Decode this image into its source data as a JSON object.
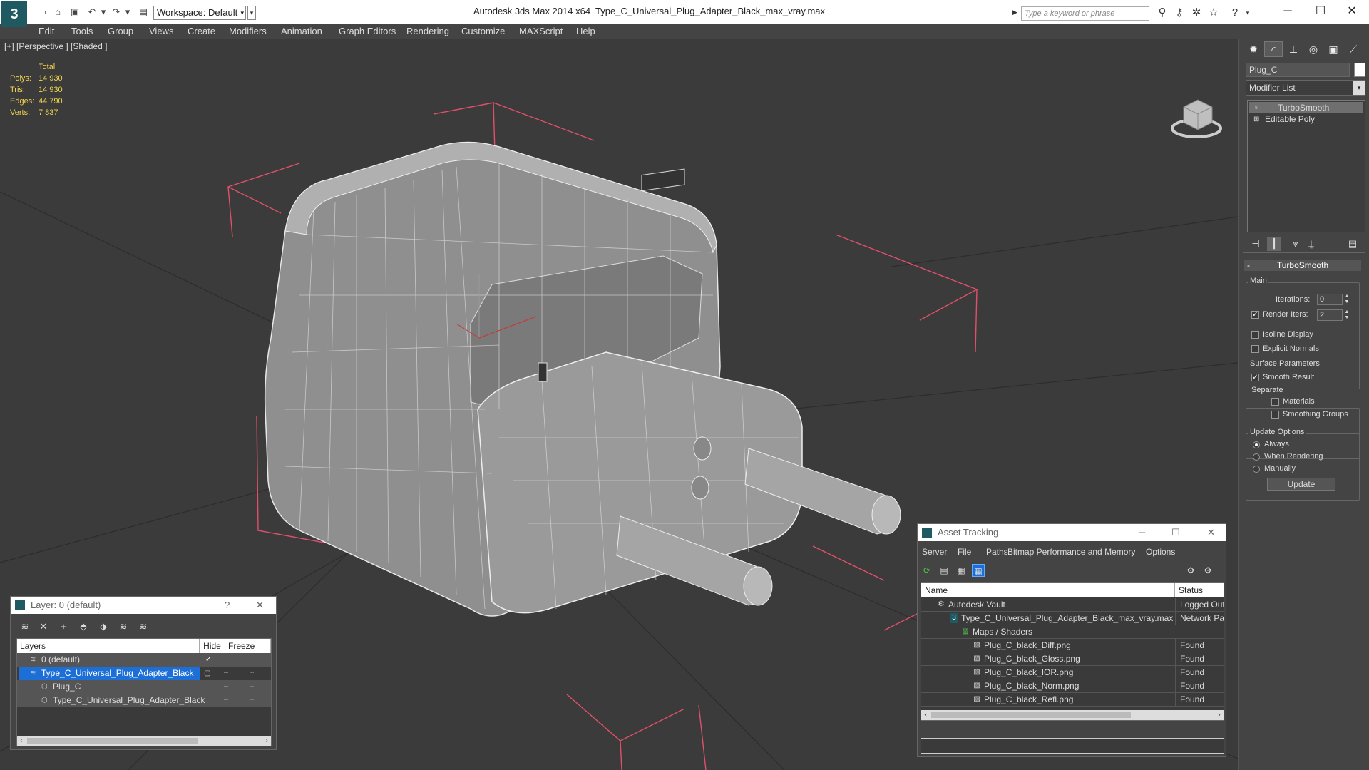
{
  "titlebar": {
    "app_title": "Autodesk 3ds Max  2014 x64",
    "file_title": "Type_C_Universal_Plug_Adapter_Black_max_vray.max",
    "workspace": "Workspace: Default",
    "search_placeholder": "Type a keyword or phrase",
    "quick_access_icons": [
      "new-file-icon",
      "open-file-icon",
      "save-icon",
      "undo-icon",
      "redo-icon",
      "project-folder-icon"
    ],
    "right_icons": [
      "binoculars-icon",
      "search-icon",
      "star-tools-icon",
      "favorites-icon",
      "help-icon"
    ]
  },
  "menu": [
    "Edit",
    "Tools",
    "Group",
    "Views",
    "Create",
    "Modifiers",
    "Animation",
    "Graph Editors",
    "Rendering",
    "Customize",
    "MAXScript",
    "Help"
  ],
  "viewport": {
    "label": "[+] [Perspective ] [Shaded ]",
    "stats": {
      "header": "Total",
      "rows": [
        {
          "k": "Polys:",
          "v": "14 930"
        },
        {
          "k": "Tris:",
          "v": "14 930"
        },
        {
          "k": "Edges:",
          "v": "44 790"
        },
        {
          "k": "Verts:",
          "v": "7 837"
        }
      ]
    }
  },
  "command_panel": {
    "tabs": [
      "create-tab-icon",
      "modify-tab-icon",
      "hierarchy-tab-icon",
      "motion-tab-icon",
      "display-tab-icon",
      "utilities-tab-icon"
    ],
    "object_name": "Plug_C",
    "modifier_list": "Modifier List",
    "stack": [
      "TurboSmooth",
      "Editable Poly"
    ],
    "rollout_title": "TurboSmooth",
    "main_group": "Main",
    "iterations_label": "Iterations:",
    "iterations_value": "0",
    "render_iters_label": "Render Iters:",
    "render_iters_value": "2",
    "render_iters_checked": true,
    "isoline_label": "Isoline Display",
    "explicit_normals_label": "Explicit Normals",
    "surface_group": "Surface Parameters",
    "smooth_result_label": "Smooth Result",
    "separate_label": "Separate",
    "materials_label": "Materials",
    "smoothing_groups_label": "Smoothing Groups",
    "update_group": "Update Options",
    "always_label": "Always",
    "when_rendering_label": "When Rendering",
    "manually_label": "Manually",
    "update_button": "Update"
  },
  "layer_dialog": {
    "title": "Layer: 0 (default)",
    "help": "?",
    "headers": {
      "layers": "Layers",
      "hide": "Hide",
      "freeze": "Freeze"
    },
    "rows": [
      {
        "name": "0 (default)"
      },
      {
        "name": "Type_C_Universal_Plug_Adapter_Black"
      },
      {
        "name": "Plug_C"
      },
      {
        "name": "Type_C_Universal_Plug_Adapter_Black"
      }
    ]
  },
  "asset_dialog": {
    "title": "Asset Tracking",
    "menu": [
      "Server",
      "File",
      "Paths",
      "Bitmap Performance and Memory",
      "Options"
    ],
    "headers": {
      "name": "Name",
      "status": "Status"
    },
    "rows": [
      {
        "name": "Autodesk Vault",
        "status": "Logged Out"
      },
      {
        "name": "Type_C_Universal_Plug_Adapter_Black_max_vray.max",
        "status": "Network Pat"
      },
      {
        "name": "Maps / Shaders",
        "status": ""
      },
      {
        "name": "Plug_C_black_Diff.png",
        "status": "Found"
      },
      {
        "name": "Plug_C_black_Gloss.png",
        "status": "Found"
      },
      {
        "name": "Plug_C_black_IOR.png",
        "status": "Found"
      },
      {
        "name": "Plug_C_black_Norm.png",
        "status": "Found"
      },
      {
        "name": "Plug_C_black_Refl.png",
        "status": "Found"
      }
    ]
  },
  "colors": {
    "viewport_bg": "#3b3b3b",
    "stats_text": "#f3d54e",
    "selection": "#1c6fd6",
    "bounding_box": "#e0506a"
  }
}
